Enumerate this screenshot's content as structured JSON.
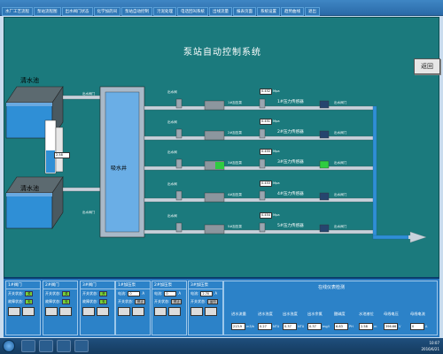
{
  "menubar": {
    "items": [
      "水厂工艺流程",
      "泵站流程图",
      "出水阀门状态",
      "化学加药间",
      "泵站自动控制",
      "污泥处理",
      "电话回叫系统",
      "出线流量",
      "报表页面",
      "系统设置",
      "趋势曲线",
      "退出"
    ]
  },
  "main": {
    "title": "泵站自动控制系统",
    "return_label": "返回"
  },
  "tanks": {
    "upper": "清水池",
    "lower": "清水池",
    "suction_well": "吸水井",
    "level_label": "液位",
    "level_value": "2.58"
  },
  "valves": {
    "upper": "出水阀门",
    "lower": "出水阀门"
  },
  "pumps": [
    {
      "motor": "1#加压泵",
      "valve": "出水阀",
      "pressure": "0.452",
      "unit": "Mpa",
      "sensor": "1#压力传感器",
      "outlet": "出水阀门"
    },
    {
      "motor": "2#加压泵",
      "valve": "出水阀",
      "pressure": "0.451",
      "unit": "Mpa",
      "sensor": "2#压力传感器",
      "outlet": "出水阀门"
    },
    {
      "motor": "3#加压泵",
      "valve": "出水阀",
      "pressure": "0.455",
      "unit": "Mpa",
      "sensor": "3#压力传感器",
      "outlet": "出水阀门"
    },
    {
      "motor": "4#加压泵",
      "valve": "出水阀",
      "pressure": "0.453",
      "unit": "Mpa",
      "sensor": "4#压力传感器",
      "outlet": "出水阀门"
    },
    {
      "motor": "5#加压泵",
      "valve": "出水阀",
      "pressure": "0.454",
      "unit": "Mpa",
      "sensor": "5#压力传感器",
      "outlet": "出水阀门"
    }
  ],
  "gates": [
    {
      "title": "1#阀门",
      "open_label": "开关状态:",
      "open_value": "关",
      "fault_label": "故障状态:",
      "fault_value": "无"
    },
    {
      "title": "2#阀门",
      "open_label": "开关状态:",
      "open_value": "关",
      "fault_label": "故障状态:",
      "fault_value": "无"
    },
    {
      "title": "3#阀门",
      "open_label": "开关状态:",
      "open_value": "开",
      "fault_label": "故障状态:",
      "fault_value": "无"
    }
  ],
  "pump_status": [
    {
      "title": "1#加压泵",
      "current_label": "电流:",
      "current_value": "0",
      "unit": "A",
      "status_label": "开关状态:",
      "status_value": "停止"
    },
    {
      "title": "2#加压泵",
      "current_label": "电流:",
      "current_value": "0",
      "unit": "A",
      "status_label": "开关状态:",
      "status_value": "停止"
    },
    {
      "title": "3#加压泵",
      "current_label": "电流:",
      "current_value": "2.70",
      "unit": "A",
      "status_label": "开关状态:",
      "status_value": "运行"
    }
  ],
  "quality": {
    "title": "在线仪表检测",
    "columns": [
      "进水流量",
      "进水浊度",
      "出水浊度",
      "出水余氯",
      "酸碱度",
      "水池液位",
      "母线电压",
      "母线电流"
    ],
    "values": [
      "213.9",
      "0.27",
      "0.37",
      "0.37",
      "6.83",
      "2.58",
      "396.66",
      "0"
    ],
    "units": [
      "m3/h",
      "NTU",
      "NTU",
      "mg/l",
      "PH",
      "m",
      "V",
      "A"
    ]
  },
  "taskbar": {
    "time": "10:07",
    "date": "2016/6/21"
  },
  "colors": {
    "canvas": "#1b7a7d",
    "pipe": "#c8d2dc",
    "running": "#2ecc40"
  }
}
